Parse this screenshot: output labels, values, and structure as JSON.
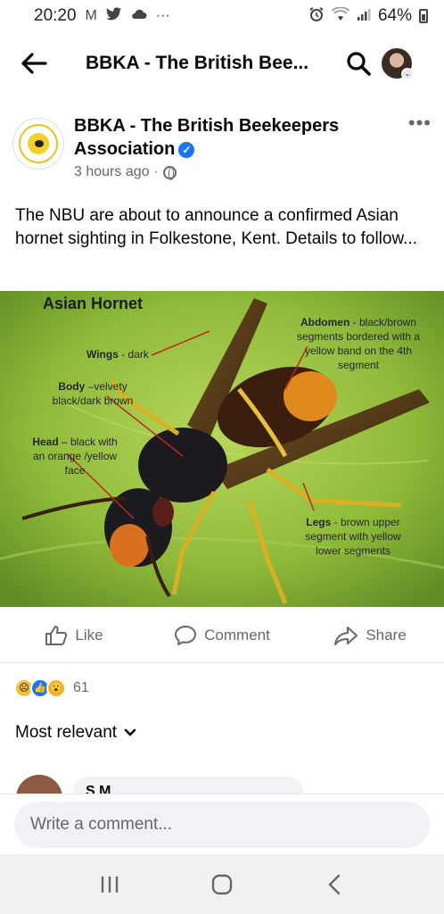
{
  "status_bar": {
    "time": "20:20",
    "left_icons": [
      "gmail-icon",
      "twitter-icon",
      "cloud-icon",
      "more-dots-icon"
    ],
    "right_icons": [
      "alarm-icon",
      "wifi-icon",
      "signal-icon"
    ],
    "battery": "64%"
  },
  "header": {
    "title": "BBKA - The British Bee..."
  },
  "post": {
    "page_name": "BBKA - The British Beekeepers Association",
    "time": "3 hours ago",
    "time_separator": "·",
    "text": "The NBU are about to announce a confirmed Asian hornet sighting in Folkestone, Kent. Details to follow...",
    "image": {
      "title": "Asian Hornet",
      "labels": {
        "wings_bold": "Wings",
        "wings_rest": " - dark",
        "body_bold": "Body",
        "body_rest": " –velvety black/dark brown",
        "head_bold": "Head",
        "head_rest": " – black with an orange /yellow face",
        "abdomen_bold": "Abdomen",
        "abdomen_rest": " - black/brown segments bordered with a yellow band on the 4th segment",
        "legs_bold": "Legs",
        "legs_rest": " - brown upper segment with yellow lower segments"
      }
    }
  },
  "actions": {
    "like": "Like",
    "comment": "Comment",
    "share": "Share"
  },
  "reactions": {
    "count": "61"
  },
  "sort": {
    "label": "Most relevant"
  },
  "comment_preview": {
    "author_partial": "S     M"
  },
  "compose": {
    "placeholder": "Write a comment..."
  }
}
